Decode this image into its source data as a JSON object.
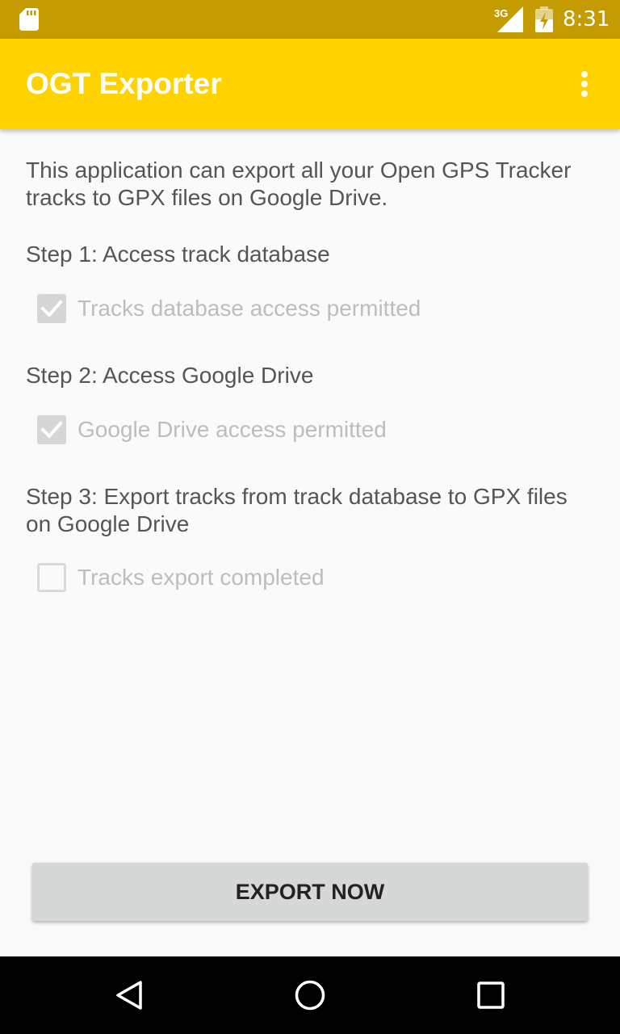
{
  "status_bar": {
    "network": "3G",
    "time": "8:31",
    "icons": [
      "sd-card-icon",
      "signal-icon",
      "battery-icon"
    ]
  },
  "app_bar": {
    "title": "OGT Exporter",
    "menu_icon": "overflow-menu-icon"
  },
  "content": {
    "intro": "This application can export all your Open GPS Tracker tracks to GPX files on Google Drive.",
    "steps": [
      {
        "heading": "Step 1: Access track database",
        "check_label": "Tracks database access permitted",
        "checked": true
      },
      {
        "heading": "Step 2: Access Google Drive",
        "check_label": "Google Drive access permitted",
        "checked": true
      },
      {
        "heading": "Step 3: Export tracks from track database to GPX files on Google Drive",
        "check_label": "Tracks export completed",
        "checked": false
      }
    ]
  },
  "export_button": {
    "label": "EXPORT NOW"
  },
  "nav_bar": {
    "icons": [
      "back-icon",
      "home-icon",
      "recents-icon"
    ]
  },
  "colors": {
    "status_bar": "#c49b00",
    "app_bar": "#ffd300",
    "background": "#fafafa",
    "button": "#d6d7d7"
  }
}
